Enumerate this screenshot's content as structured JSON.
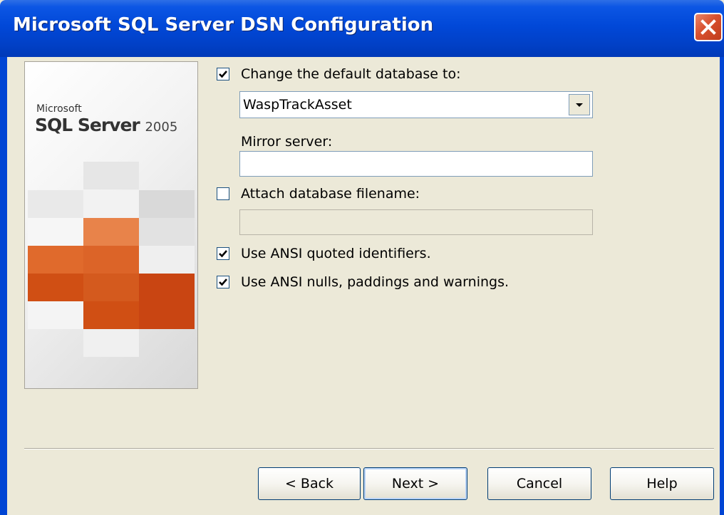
{
  "window": {
    "title": "Microsoft SQL Server DSN Configuration",
    "close_icon": "close-icon"
  },
  "banner": {
    "brand": "Microsoft",
    "product": "SQL Server",
    "version": "2005",
    "tile_colors": [
      "#E8834A",
      "#E06A2C",
      "#D04F14",
      "#C94512",
      "#D45A1E"
    ]
  },
  "options": {
    "change_default_db": {
      "label": "Change the default database to:",
      "checked": true
    },
    "database_value": "WaspTrackAsset",
    "mirror_server": {
      "label": "Mirror server:",
      "value": ""
    },
    "attach_db": {
      "label": "Attach database filename:",
      "checked": false,
      "value": ""
    },
    "ansi_quoted": {
      "label": "Use ANSI quoted identifiers.",
      "checked": true
    },
    "ansi_nulls": {
      "label": "Use ANSI nulls, paddings and warnings.",
      "checked": true
    }
  },
  "buttons": {
    "back": "< Back",
    "next": "Next >",
    "cancel": "Cancel",
    "help": "Help"
  }
}
